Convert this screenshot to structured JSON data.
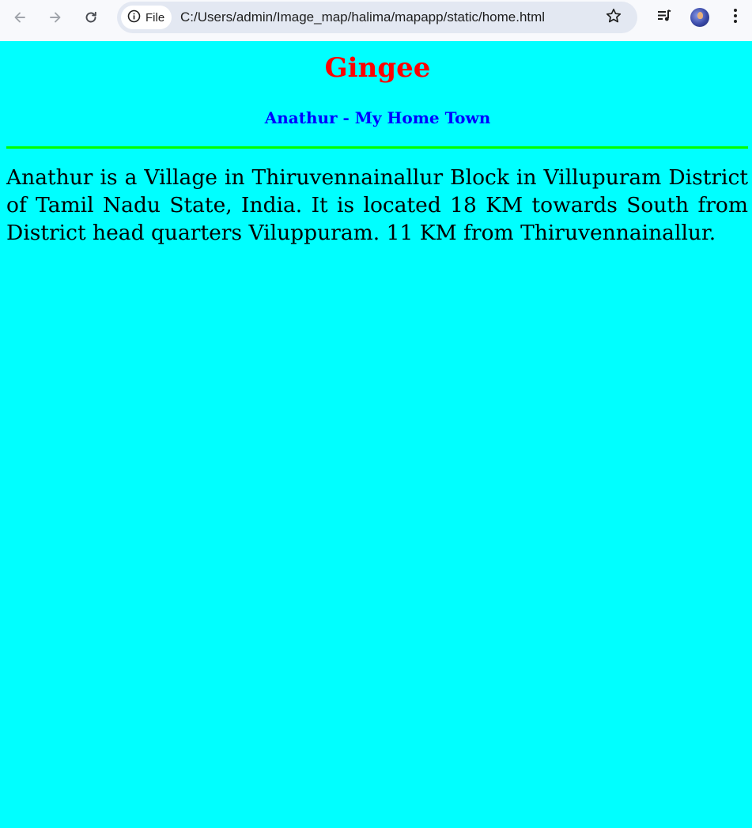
{
  "browser": {
    "site_info_label": "File",
    "url": "C:/Users/admin/Image_map/halima/mapapp/static/home.html",
    "icons": {
      "back": "back-arrow-icon",
      "forward": "forward-arrow-icon",
      "reload": "reload-icon",
      "site_info": "info-circle-icon",
      "bookmark": "star-icon",
      "media": "media-queue-icon",
      "profile": "avatar",
      "menu": "kebab-menu-icon"
    }
  },
  "page": {
    "background_color": "#00ffff",
    "title": "Gingee",
    "title_color": "#ff0000",
    "subtitle": "Anathur - My Home Town",
    "subtitle_color": "#0000ff",
    "divider_color": "#00ff00",
    "description": "Anathur is a Village in Thiruvennainallur Block in Villupuram District of Tamil Nadu State, India. It is located 18 KM towards South from District head quarters Viluppuram. 11 KM from Thiruvennainallur."
  }
}
